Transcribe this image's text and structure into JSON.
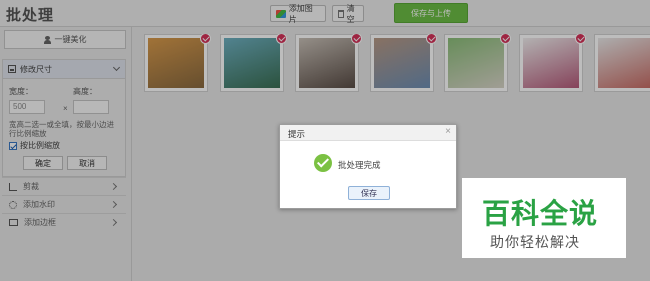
{
  "app": {
    "title": "批处理"
  },
  "toolbar": {
    "add_photo_label": "添加图片",
    "clear_label": "清空",
    "save_upload_label": "保存与上传"
  },
  "sidebar": {
    "beautify_label": "一键美化",
    "resize": {
      "title": "修改尺寸",
      "width_label": "宽度：",
      "height_label": "高度：",
      "width_value": "500",
      "height_value": "",
      "times": "×",
      "hint": "宽高二选一或全填，按最小边进行比例缩放",
      "keep_ratio_label": "按比例缩放",
      "keep_ratio_checked": true,
      "ok_label": "确定",
      "cancel_label": "取消"
    },
    "rows": [
      {
        "label": "剪裁",
        "icon": "crop-icon"
      },
      {
        "label": "添加水印",
        "icon": "watermark-icon"
      },
      {
        "label": "添加边框",
        "icon": "frame-icon"
      }
    ]
  },
  "photos": [
    {
      "colors": [
        "#d99b4c",
        "#8a6a40"
      ],
      "checked": true
    },
    {
      "colors": [
        "#6fb1c2",
        "#3b6f54"
      ],
      "checked": true
    },
    {
      "colors": [
        "#c9c1b8",
        "#5a4d46"
      ],
      "checked": true
    },
    {
      "colors": [
        "#b89a86",
        "#6e8fb4"
      ],
      "checked": true
    },
    {
      "colors": [
        "#8cbf7a",
        "#d9d5c9"
      ],
      "checked": true
    },
    {
      "colors": [
        "#f1efef",
        "#b55a7a"
      ],
      "checked": true
    },
    {
      "colors": [
        "#eaeaea",
        "#c76a63"
      ],
      "checked": true
    }
  ],
  "dialog": {
    "title": "提示",
    "close": "×",
    "message": "批处理完成",
    "save_label": "保存"
  },
  "watermark": {
    "big": "百科全说",
    "small": "助你轻松解决"
  }
}
